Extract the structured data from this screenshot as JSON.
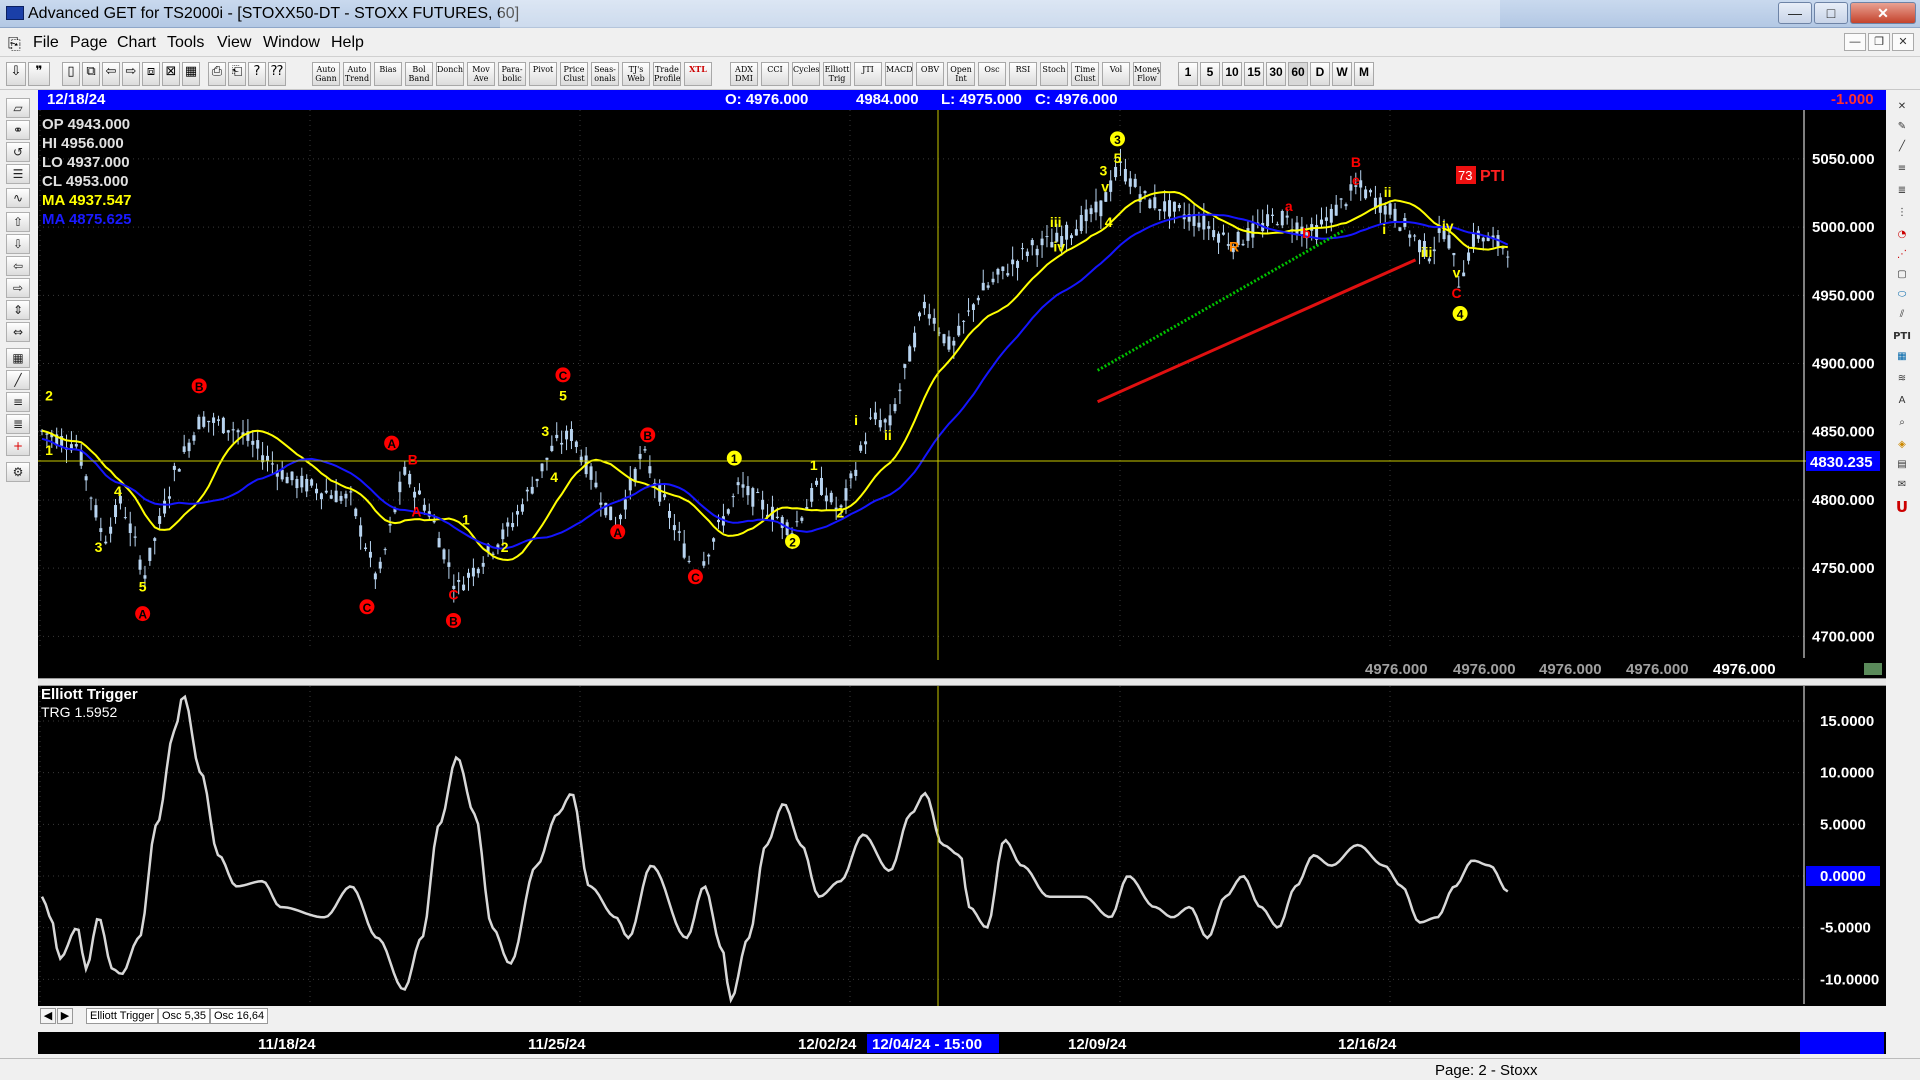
{
  "window": {
    "title": "Advanced GET for TS2000i - [STOXX50-DT - STOXX FUTURES, 60]",
    "buttons": {
      "minimize": "—",
      "maximize": "□",
      "close": "✕"
    }
  },
  "menu": [
    "File",
    "Page",
    "Chart",
    "Tools",
    "View",
    "Window",
    "Help"
  ],
  "toolbar": {
    "buttons": [
      "Auto Gann",
      "Auto Trend",
      "Bias",
      "Bol Band",
      "Donch",
      "Mov Ave",
      "Para- bolic",
      "Pivot",
      "Price Clust",
      "Seas- onals",
      "TJ's Web",
      "Trade Profile",
      "XTL",
      "ADX DMI",
      "CCI",
      "Cycles",
      "Elliott Trig",
      "JTI",
      "MACD",
      "OBV",
      "Open Int",
      "Osc",
      "RSI",
      "Stoch",
      "Time Clust",
      "Vol",
      "Money Flow"
    ],
    "periods": [
      "1",
      "5",
      "10",
      "15",
      "30",
      "60",
      "D",
      "W",
      "M"
    ]
  },
  "header": {
    "date": "12/18/24",
    "open": "O: 4976.000",
    "high": "4984.000",
    "low": "L: 4975.000",
    "close": "C: 4976.000",
    "change": "-1.000"
  },
  "legend": {
    "op": "OP  4943.000",
    "hi": "HI   4956.000",
    "lo": "LO  4937.000",
    "cl": "CL  4953.000",
    "ma1": "MA  4937.547",
    "ma2": "MA  4875.625"
  },
  "price_axis": [
    "5050.000",
    "5000.000",
    "4950.000",
    "4900.000",
    "4850.000",
    "4800.000",
    "4750.000",
    "4700.000"
  ],
  "cursor_price": "4830.235",
  "pti_badge": "73",
  "pti_label": "PTI",
  "bottom_values": [
    "4976.000",
    "4976.000",
    "4976.000",
    "4976.000",
    "4976.000"
  ],
  "oscillator": {
    "title": "Elliott Trigger",
    "value": "TRG 1.5952",
    "axis": [
      "15.0000",
      "10.0000",
      "5.0000",
      "0.0000",
      "-5.0000",
      "-10.0000"
    ]
  },
  "tabs": [
    "Elliott Trigger",
    "Osc 5,35",
    "Osc 16,64"
  ],
  "dates": [
    "11/18/24",
    "11/25/24",
    "12/02/24",
    "12/09/24",
    "12/16/24"
  ],
  "cursor_date": "12/04/24 - 15:00",
  "status": "Page: 2 - Stoxx",
  "chart_data": {
    "type": "candlestick",
    "symbol": "STOXX50-DT",
    "interval": "60",
    "ylim": [
      4690,
      5080
    ],
    "osc_ylim": [
      -12,
      18
    ],
    "labels": [
      {
        "t": "2",
        "x": 0.004,
        "y": 4873,
        "c": "#ffff00"
      },
      {
        "t": "1",
        "x": 0.004,
        "y": 4833,
        "c": "#ffff00"
      },
      {
        "t": "3",
        "x": 0.032,
        "y": 4762,
        "c": "#ffff00"
      },
      {
        "t": "4",
        "x": 0.043,
        "y": 4803,
        "c": "#ffff00"
      },
      {
        "t": "5",
        "x": 0.057,
        "y": 4733,
        "c": "#ffff00"
      },
      {
        "t": "A",
        "x": 0.057,
        "y": 4713,
        "c": "#ff0000",
        "circ": 1
      },
      {
        "t": "B",
        "x": 0.089,
        "y": 4880,
        "c": "#ff0000",
        "circ": 1
      },
      {
        "t": "C",
        "x": 0.184,
        "y": 4718,
        "c": "#ff0000",
        "circ": 1
      },
      {
        "t": "A",
        "x": 0.198,
        "y": 4838,
        "c": "#ff0000",
        "circ": 1
      },
      {
        "t": "B",
        "x": 0.21,
        "y": 4826,
        "c": "#ff0000"
      },
      {
        "t": "A",
        "x": 0.212,
        "y": 4788,
        "c": "#ff0000"
      },
      {
        "t": "1",
        "x": 0.24,
        "y": 4782,
        "c": "#ffff00"
      },
      {
        "t": "C",
        "x": 0.233,
        "y": 4727,
        "c": "#ff0000"
      },
      {
        "t": "B",
        "x": 0.233,
        "y": 4708,
        "c": "#ff0000",
        "circ": 1
      },
      {
        "t": "2",
        "x": 0.262,
        "y": 4762,
        "c": "#ffff00"
      },
      {
        "t": "3",
        "x": 0.285,
        "y": 4847,
        "c": "#ffff00"
      },
      {
        "t": "4",
        "x": 0.29,
        "y": 4813,
        "c": "#ffff00"
      },
      {
        "t": "C",
        "x": 0.295,
        "y": 4888,
        "c": "#ff0000",
        "circ": 1
      },
      {
        "t": "5",
        "x": 0.295,
        "y": 4873,
        "c": "#ffff00"
      },
      {
        "t": "A",
        "x": 0.326,
        "y": 4773,
        "c": "#ff0000",
        "circ": 1
      },
      {
        "t": "B",
        "x": 0.343,
        "y": 4844,
        "c": "#ff0000",
        "circ": 1
      },
      {
        "t": "C",
        "x": 0.37,
        "y": 4740,
        "c": "#ff0000",
        "circ": 1
      },
      {
        "t": "1",
        "x": 0.392,
        "y": 4827,
        "c": "#ffff00",
        "circ": 1
      },
      {
        "t": "2",
        "x": 0.425,
        "y": 4766,
        "c": "#ffff00",
        "circ": 1
      },
      {
        "t": "1",
        "x": 0.437,
        "y": 4822,
        "c": "#ffff00"
      },
      {
        "t": "2",
        "x": 0.452,
        "y": 4787,
        "c": "#ffff00"
      },
      {
        "t": "i",
        "x": 0.461,
        "y": 4855,
        "c": "#ffff00"
      },
      {
        "t": "ii",
        "x": 0.479,
        "y": 4844,
        "c": "#ffff00"
      },
      {
        "t": "iii",
        "x": 0.574,
        "y": 5000,
        "c": "#ffff00"
      },
      {
        "t": "iv",
        "x": 0.576,
        "y": 4982,
        "c": "#ffff00"
      },
      {
        "t": "3",
        "x": 0.601,
        "y": 5038,
        "c": "#ffff00"
      },
      {
        "t": "v",
        "x": 0.602,
        "y": 5026,
        "c": "#ffff00"
      },
      {
        "t": "4",
        "x": 0.604,
        "y": 5000,
        "c": "#ffff00"
      },
      {
        "t": "3",
        "x": 0.609,
        "y": 5061,
        "c": "#ffff00",
        "circ": 1
      },
      {
        "t": "5",
        "x": 0.609,
        "y": 5047,
        "c": "#ffff00"
      },
      {
        "t": "R",
        "x": 0.675,
        "y": 4982,
        "c": "#ff8800"
      },
      {
        "t": "a",
        "x": 0.706,
        "y": 5012,
        "c": "#ff0000"
      },
      {
        "t": "b",
        "x": 0.716,
        "y": 4992,
        "c": "#ff0000"
      },
      {
        "t": "B",
        "x": 0.744,
        "y": 5044,
        "c": "#ff0000"
      },
      {
        "t": "e",
        "x": 0.744,
        "y": 5031,
        "c": "#ff0000"
      },
      {
        "t": "ii",
        "x": 0.762,
        "y": 5022,
        "c": "#ffff00"
      },
      {
        "t": "i",
        "x": 0.76,
        "y": 4995,
        "c": "#ffff00"
      },
      {
        "t": "iii",
        "x": 0.784,
        "y": 4978,
        "c": "#ffff00"
      },
      {
        "t": "iv",
        "x": 0.796,
        "y": 4997,
        "c": "#ffff00"
      },
      {
        "t": "v",
        "x": 0.801,
        "y": 4963,
        "c": "#ffff00"
      },
      {
        "t": "C",
        "x": 0.801,
        "y": 4948,
        "c": "#ff0000"
      },
      {
        "t": "4",
        "x": 0.803,
        "y": 4933,
        "c": "#ffff00",
        "circ": 1
      }
    ]
  }
}
